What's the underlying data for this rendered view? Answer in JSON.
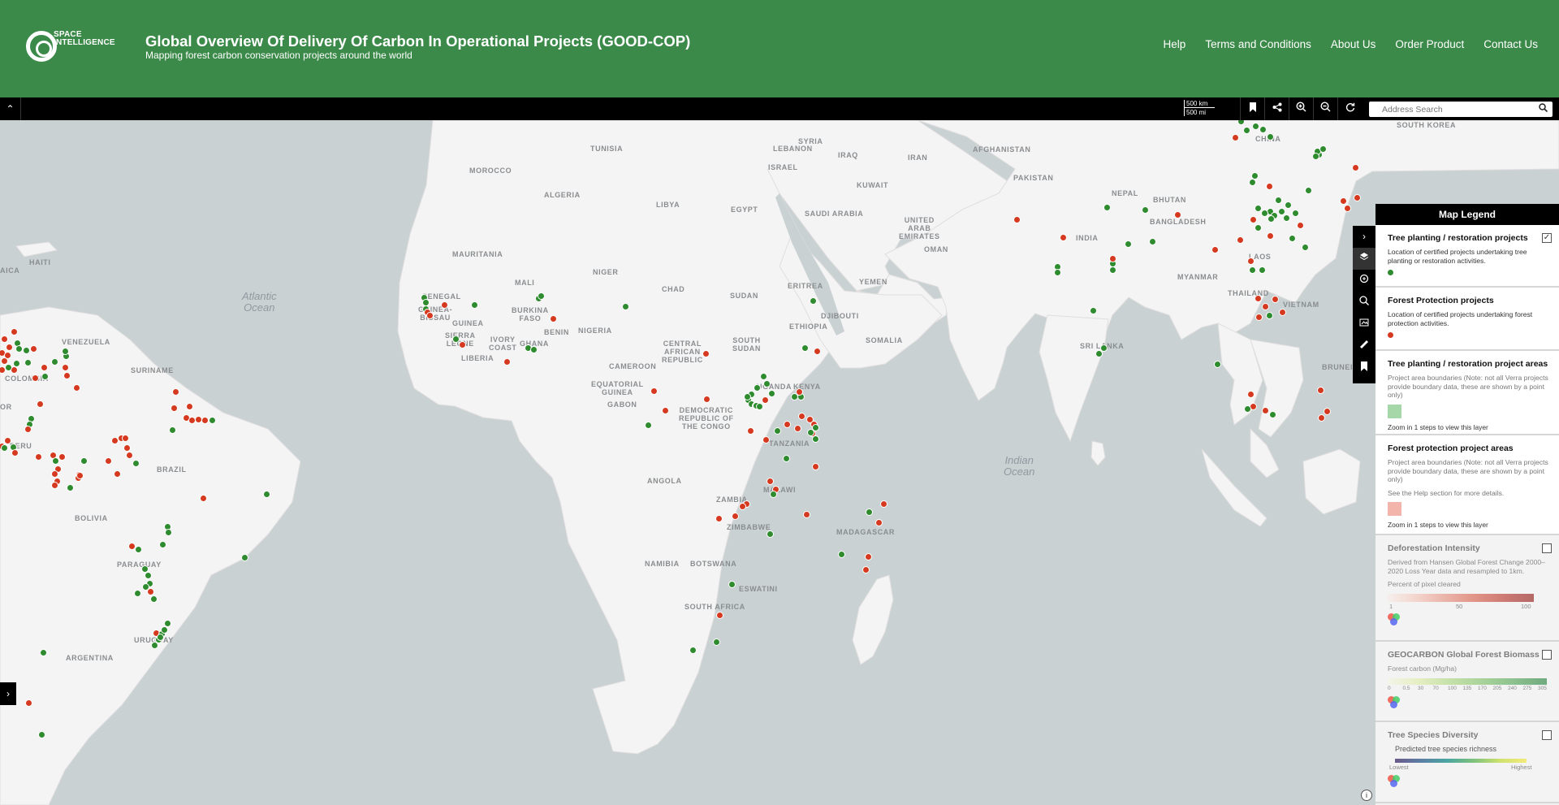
{
  "header": {
    "logo_text": "SPACE\nINTELLIGENCE",
    "title": "Global Overview Of Delivery Of Carbon In Operational Projects (GOOD-COP)",
    "subtitle": "Mapping forest carbon conservation projects around the world",
    "nav": [
      "Help",
      "Terms and Conditions",
      "About Us",
      "Order Product",
      "Contact Us"
    ]
  },
  "toolbar": {
    "collapse_icon": "chevron-up-icon",
    "scale_km": "500 km",
    "scale_mi": "500 mi",
    "tools": [
      "bookmark-icon",
      "share-icon",
      "zoom-in-icon",
      "zoom-out-icon",
      "refresh-icon"
    ],
    "search_placeholder": "Address Search",
    "search_icon": "search-icon"
  },
  "map": {
    "oceans": [
      "Atlantic\nOcean",
      "Indian\nOcean"
    ],
    "places": [
      "TUNISIA",
      "MOROCCO",
      "ALGERIA",
      "LIBYA",
      "EGYPT",
      "SYRIA",
      "LEBANON",
      "ISRAEL",
      "IRAQ",
      "IRAN",
      "AFGHANISTAN",
      "PAKISTAN",
      "KUWAIT",
      "SAUDI ARABIA",
      "UNITED\nARAB\nEMIRATES",
      "OMAN",
      "YEMEN",
      "NEPAL",
      "BHUTAN",
      "BANGLADESH",
      "INDIA",
      "MYANMAR",
      "LAOS",
      "THAILAND",
      "VIETNAM",
      "SRI LANKA",
      "BRUNEI",
      "SOUTH KOREA",
      "CHINA",
      "MAURITANIA",
      "MALI",
      "NIGER",
      "CHAD",
      "SUDAN",
      "ERITREA",
      "DJIBOUTI",
      "ETHIOPIA",
      "SOMALIA",
      "SENEGAL",
      "GUINEA-\nBISSAU",
      "GUINEA",
      "SIERRA\nLEONE",
      "LIBERIA",
      "BURKINA\nFASO",
      "IVORY\nCOAST",
      "GHANA",
      "BENIN",
      "NIGERIA",
      "CAMEROON",
      "EQUATORIAL\nGUINEA",
      "GABON",
      "CENTRAL\nAFRICAN\nREPUBLIC",
      "SOUTH\nSUDAN",
      "UGANDA",
      "KENYA",
      "DEMOCRATIC\nREPUBLIC OF\nTHE CONGO",
      "TANZANIA",
      "ANGOLA",
      "ZAMBIA",
      "MALAWI",
      "ZIMBABWE",
      "MADAGASCAR",
      "NAMIBIA",
      "BOTSWANA",
      "ESWATINI",
      "SOUTH AFRICA",
      "HAITI",
      "JAMAICA",
      "VENEZUELA",
      "SURINAME",
      "COLOMBIA",
      "PERU",
      "BRAZIL",
      "BOLIVIA",
      "PARAGUAY",
      "URUGUAY",
      "ARGENTINA",
      "ECUADOR"
    ],
    "tree_planting_points": 84,
    "forest_protection_points": 73
  },
  "side_tools": [
    "chevron-right-icon",
    "layers-icon",
    "identify-icon",
    "zoom-to-icon",
    "basemap-icon",
    "measure-icon",
    "bookmark-icon"
  ],
  "legend": {
    "title": "Map Legend",
    "sections": [
      {
        "title": "Tree planting / restoration projects",
        "desc": "Location of certified projects undertaking tree planting or restoration activities.",
        "checked": "✓",
        "color": "#2e8b2e"
      },
      {
        "title": "Forest Protection projects",
        "desc": "Location of certified projects undertaking forest protection activities.",
        "color": "#d53a20"
      },
      {
        "title": "Tree planting / restoration project areas",
        "desc": "Project area boundaries (Note: not all Verra projects provide boundary data, these are shown by a point only)",
        "zoom": "Zoom in 1 steps to view this layer",
        "color": "#a6d7a8"
      },
      {
        "title": "Forest protection project areas",
        "desc": "Project area boundaries (Note: not all Verra projects provide boundary data, these are shown by a point only)",
        "desc2": "See the Help section for more details.",
        "zoom": "Zoom in 1 steps to view this layer",
        "color": "#f2b4ab"
      },
      {
        "title": "Deforestation Intensity",
        "desc": "Derived from Hansen Global Forest Change 2000–2020 Loss Year data and resampled to 1km.",
        "desc2": "Percent of pixel cleared",
        "ticks": [
          "1",
          "50",
          "100"
        ]
      },
      {
        "title": "GEOCARBON Global Forest Biomass",
        "desc": "Forest carbon (Mg/ha)",
        "ticks": [
          "0",
          "0.5",
          "30",
          "70",
          "100",
          "135",
          "170",
          "205",
          "240",
          "275",
          "305"
        ]
      },
      {
        "title": "Tree Species Diversity",
        "desc": "Predicted tree species richness",
        "low": "Lowest",
        "high": "Highest"
      }
    ]
  }
}
